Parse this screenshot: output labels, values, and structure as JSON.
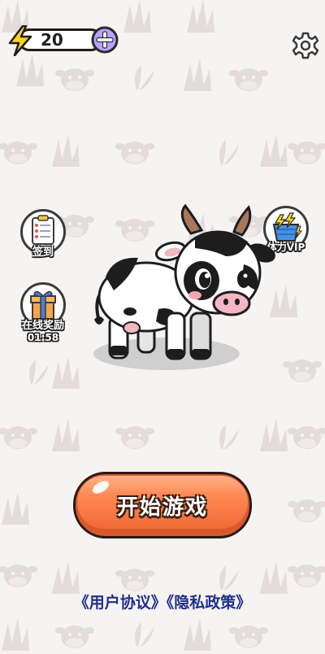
{
  "hud": {
    "energy_value": "20",
    "energy_icon": "lightning-bolt-icon",
    "add_icon": "plus-icon",
    "settings_icon": "gear-icon"
  },
  "side_buttons": {
    "checkin": {
      "label": "签到",
      "icon": "clipboard-icon"
    },
    "vip": {
      "label": "体力VIP",
      "icon": "energy-basket-icon"
    },
    "online_reward": {
      "label": "在线奖励",
      "timer": "01:58",
      "icon": "gift-box-icon"
    }
  },
  "start_button": {
    "label": "开始游戏"
  },
  "footer": {
    "user_agreement": "《用户协议》",
    "privacy_policy": "《隐私政策》"
  },
  "colors": {
    "background": "#f6f3f3",
    "start_button": "#ff8a55",
    "link": "#1f2f8c",
    "energy_bolt": "#ffd21f",
    "plus_button": "#b9a2ff"
  }
}
